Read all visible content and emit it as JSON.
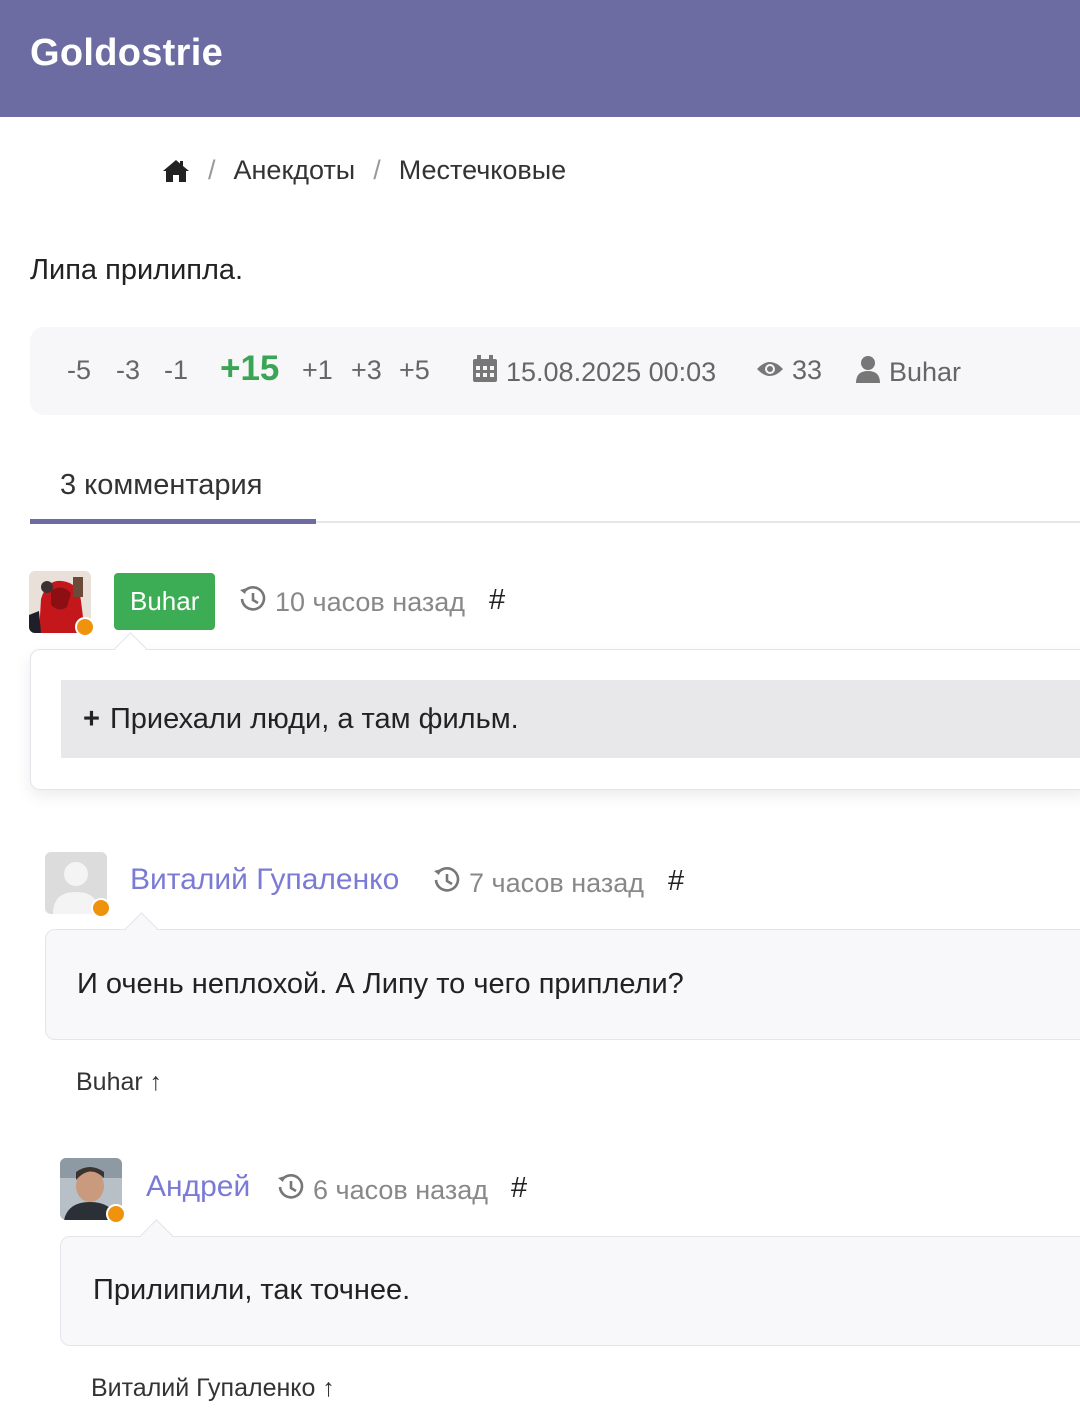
{
  "header": {
    "brand": "Goldostrie"
  },
  "breadcrumb": {
    "items": [
      "Анекдоты",
      "Местечковые"
    ],
    "separator": "/"
  },
  "joke": {
    "text": "Липа прилипла."
  },
  "rating": {
    "votes_down": [
      "-5",
      "-3",
      "-1"
    ],
    "score": "+15",
    "votes_up": [
      "+1",
      "+3",
      "+5"
    ]
  },
  "meta": {
    "date": "15.08.2025 00:03",
    "views": "33",
    "author": "Buhar"
  },
  "tabs": {
    "comments_label": "3 комментария"
  },
  "comments": [
    {
      "author": "Buhar",
      "time": "10 часов назад",
      "hash": "#",
      "text": "Приехали люди, а там фильм.",
      "is_author": true
    },
    {
      "author": "Виталий Гупаленко",
      "time": "7 часов назад",
      "hash": "#",
      "text": "И очень неплохой. А Липу то чего приплели?",
      "reply_to": "Buhar ↑"
    },
    {
      "author": "Андрей",
      "time": "6 часов назад",
      "hash": "#",
      "text": "Прилипили, так точнее.",
      "reply_to": "Виталий Гупаленко ↑"
    }
  ],
  "colors": {
    "header_bg": "#6c6ca3",
    "score": "#3aa655",
    "author_badge": "#3cac55",
    "link": "#7b7bd6",
    "online_dot": "#f0930c"
  }
}
